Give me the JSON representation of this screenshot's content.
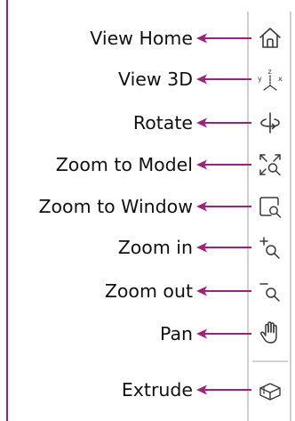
{
  "toolbar": {
    "items": [
      {
        "label": "View Home",
        "icon": "home-icon"
      },
      {
        "label": "View 3D",
        "icon": "axes-3d-icon"
      },
      {
        "label": "Rotate",
        "icon": "rotate-icon"
      },
      {
        "label": "Zoom to Model",
        "icon": "zoom-to-model-icon"
      },
      {
        "label": "Zoom to Window",
        "icon": "zoom-to-window-icon"
      },
      {
        "label": "Zoom in",
        "icon": "zoom-in-icon"
      },
      {
        "label": "Zoom out",
        "icon": "zoom-out-icon"
      },
      {
        "label": "Pan",
        "icon": "hand-icon"
      },
      {
        "label": "Extrude",
        "icon": "extrude-icon"
      }
    ]
  },
  "colors": {
    "arrow": "#a0207a",
    "icon": "#3a3a3a",
    "toolbar_border": "#cfcfcf"
  }
}
